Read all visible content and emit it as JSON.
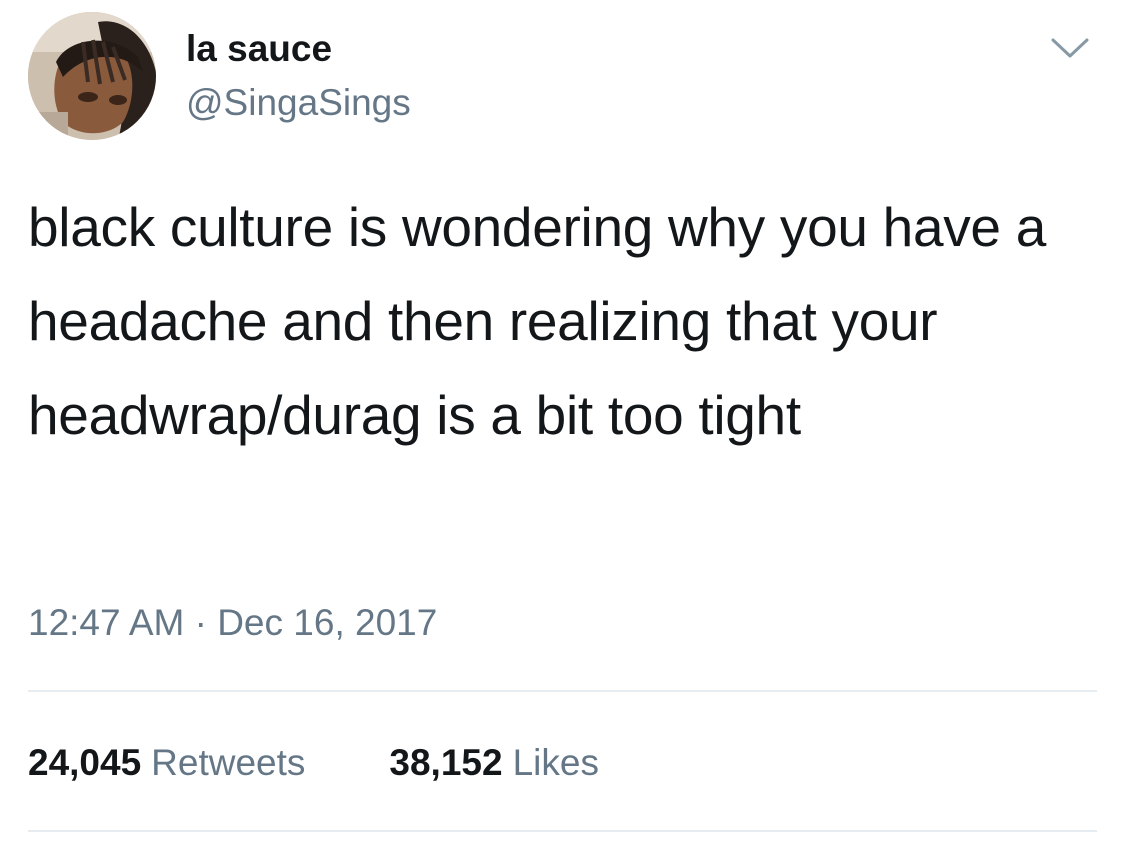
{
  "tweet": {
    "author": {
      "display_name": "la sauce",
      "handle": "@SingaSings",
      "avatar_icon": "profile-photo"
    },
    "menu_icon": "chevron-down-icon",
    "text": "black culture is wondering why you have a headache and then realizing that your headwrap/durag is a bit too tight",
    "timestamp": "12:47 AM · Dec 16, 2017",
    "stats": {
      "retweets_count": "24,045",
      "retweets_label": "Retweets",
      "likes_count": "38,152",
      "likes_label": "Likes"
    }
  },
  "colors": {
    "text_primary": "#14171a",
    "text_secondary": "#657786",
    "divider": "#e6ecf0",
    "background": "#ffffff"
  }
}
